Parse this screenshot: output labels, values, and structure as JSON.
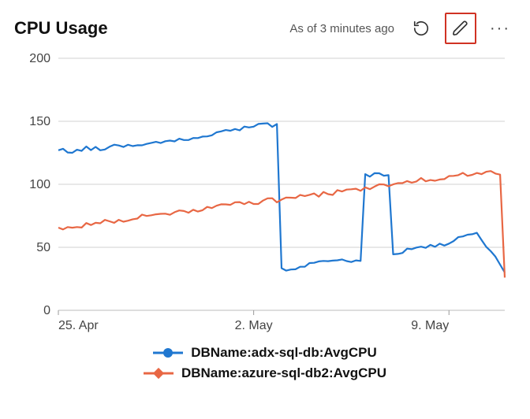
{
  "header": {
    "title": "CPU Usage",
    "status": "As of 3 minutes ago"
  },
  "colors": {
    "series1": "#1f77d0",
    "series2": "#e86744",
    "grid": "#d0d0d0",
    "axis": "#888"
  },
  "chart_data": {
    "type": "line",
    "title": "CPU Usage",
    "xlabel": "",
    "ylabel": "",
    "ylim": [
      0,
      200
    ],
    "x_ticks": [
      "25. Apr",
      "2. May",
      "9. May"
    ],
    "y_ticks": [
      0,
      50,
      100,
      150,
      200
    ],
    "legend_position": "bottom",
    "series": [
      {
        "name": "DBName:adx-sql-db:AvgCPU",
        "color": "#1f77d0",
        "marker": "circle",
        "x": [
          0,
          1,
          2,
          3,
          4,
          5,
          6,
          7,
          8,
          9,
          10,
          11,
          12,
          13,
          14,
          15,
          16
        ],
        "values": [
          126,
          128,
          130,
          132,
          135,
          138,
          142,
          147,
          32,
          36,
          40,
          108,
          46,
          50,
          54,
          62,
          30
        ]
      },
      {
        "name": "DBName:azure-sql-db2:AvgCPU",
        "color": "#e86744",
        "marker": "diamond",
        "x": [
          0,
          1,
          2,
          3,
          4,
          5,
          6,
          7,
          8,
          9,
          10,
          11,
          12,
          13,
          14,
          15,
          16
        ],
        "values": [
          65,
          68,
          71,
          74,
          77,
          80,
          83,
          86,
          88,
          91,
          94,
          97,
          100,
          103,
          106,
          109,
          26
        ]
      }
    ]
  },
  "legend": {
    "items": [
      {
        "label": "DBName:adx-sql-db:AvgCPU"
      },
      {
        "label": "DBName:azure-sql-db2:AvgCPU"
      }
    ]
  }
}
